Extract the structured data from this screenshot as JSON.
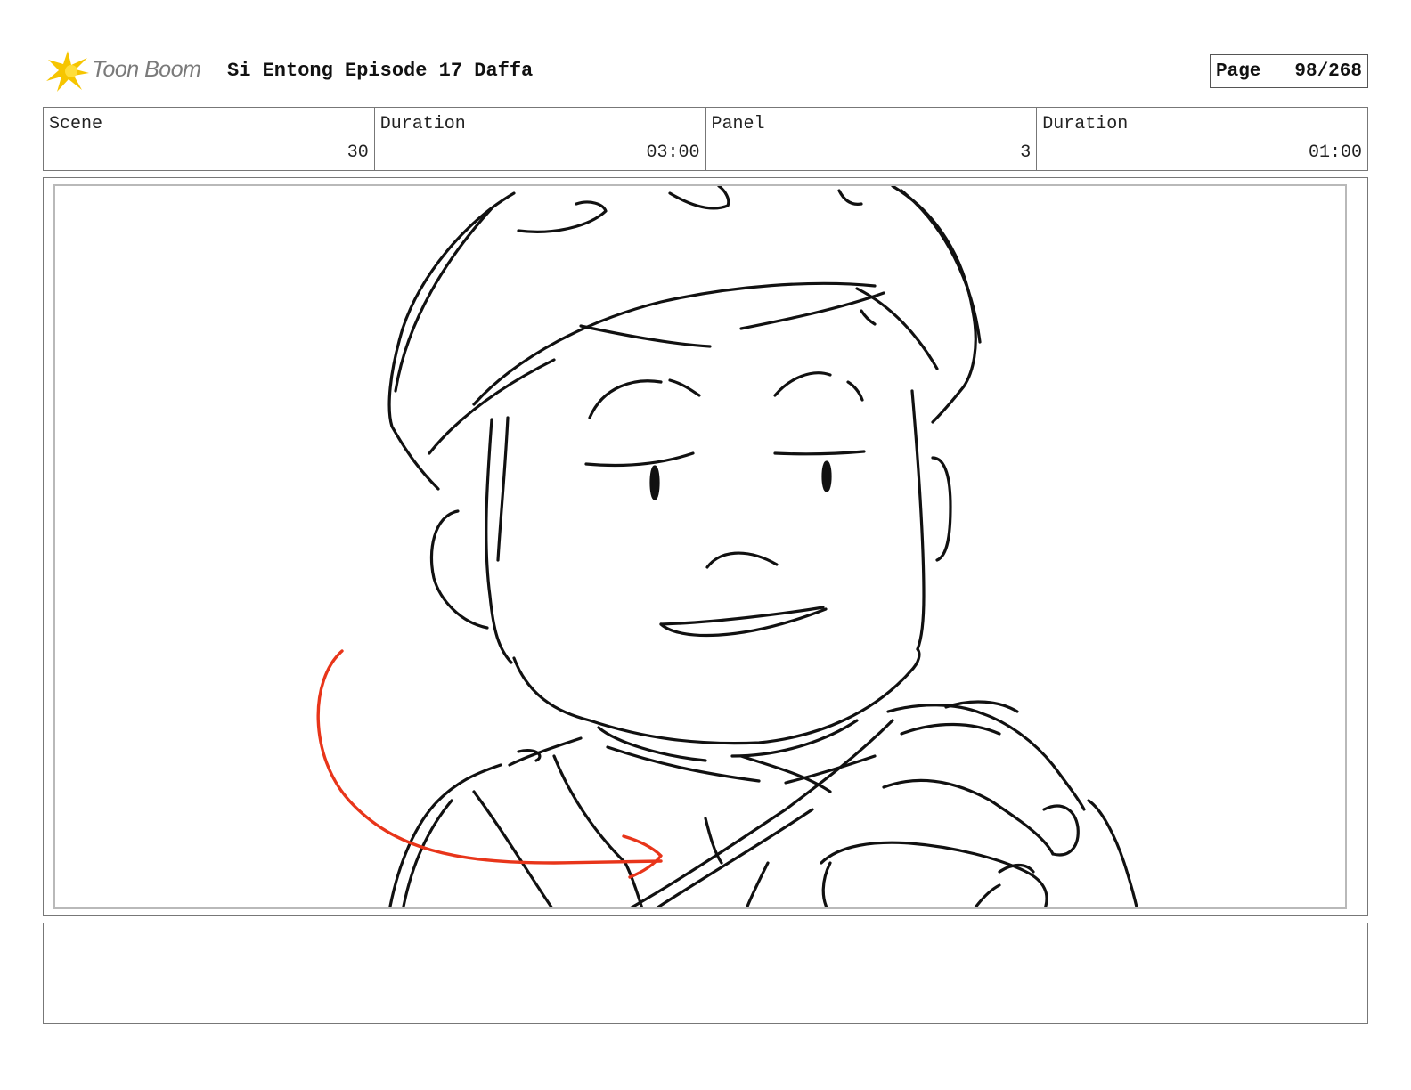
{
  "header": {
    "logo_text": "Toon Boom",
    "title": "Si Entong Episode 17 Daffa",
    "page_label": "Page",
    "page_value": "98/268"
  },
  "info": {
    "scene_label": "Scene",
    "scene_value": "30",
    "scene_duration_label": "Duration",
    "scene_duration_value": "03:00",
    "panel_label": "Panel",
    "panel_value": "3",
    "panel_duration_label": "Duration",
    "panel_duration_value": "01:00"
  },
  "colors": {
    "logo_star": "#f6c500",
    "annotation_arrow": "#e8351a"
  },
  "notes": {
    "text": ""
  }
}
